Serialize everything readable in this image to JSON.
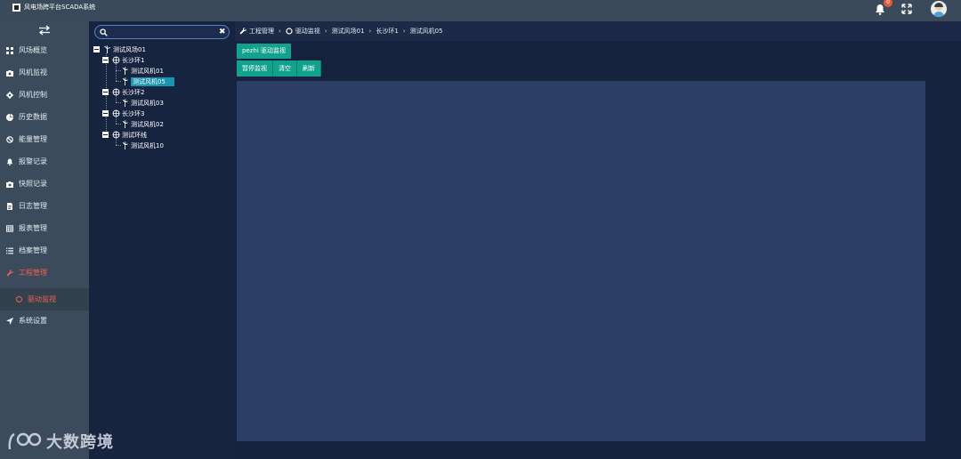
{
  "app": {
    "title": "风电场跨平台SCADA系统",
    "notification_count": "0"
  },
  "icons": {
    "logo": "app-logo-icon",
    "bell": "bell-icon",
    "fullscreen": "fullscreen-icon",
    "avatar": "user-avatar",
    "collapse": "menu-collapse-icon"
  },
  "colors": {
    "accent": "#10a28c",
    "active_nav": "#f0624d",
    "selected_node": "#1793b3",
    "topbar": "#3a4a5a",
    "sidebar": "#3c4b5b",
    "canvas": "#2d3e67"
  },
  "sidebar": {
    "items": [
      {
        "label": "风场概览",
        "icon": "grid-icon"
      },
      {
        "label": "风机监视",
        "icon": "camera-icon"
      },
      {
        "label": "风机控制",
        "icon": "gear-icon"
      },
      {
        "label": "历史数据",
        "icon": "pie-chart-icon"
      },
      {
        "label": "能量管理",
        "icon": "no-entry-icon"
      },
      {
        "label": "报警记录",
        "icon": "bell-icon"
      },
      {
        "label": "快照记录",
        "icon": "camera-icon"
      },
      {
        "label": "日志管理",
        "icon": "document-icon"
      },
      {
        "label": "报表管理",
        "icon": "table-icon"
      },
      {
        "label": "档案管理",
        "icon": "list-icon"
      },
      {
        "label": "工程管理",
        "icon": "wrench-icon"
      },
      {
        "label": "系统设置",
        "icon": "arrow-icon"
      }
    ],
    "sub_item": {
      "label": "驱动监视",
      "icon": "circle-icon"
    }
  },
  "search": {
    "value": "",
    "placeholder": ""
  },
  "tree": {
    "root": "测试风场01",
    "groups": [
      {
        "label": "长沙环1",
        "children": [
          "测试风机01",
          "测试风机05"
        ]
      },
      {
        "label": "长沙环2",
        "children": [
          "测试风机03"
        ]
      },
      {
        "label": "长沙环3",
        "children": [
          "测试风机02"
        ]
      },
      {
        "label": "测试环线",
        "children": [
          "测试风机10"
        ]
      }
    ],
    "selected": "测试风机05"
  },
  "breadcrumb": [
    "工程管理",
    "驱动监视",
    "测试风场01",
    "长沙环1",
    "测试风机05"
  ],
  "main": {
    "tab_label": "pezhi 驱动监视",
    "buttons": [
      "暂停监视",
      "清空",
      "刷新"
    ]
  },
  "watermark": {
    "text": "大数跨境"
  }
}
